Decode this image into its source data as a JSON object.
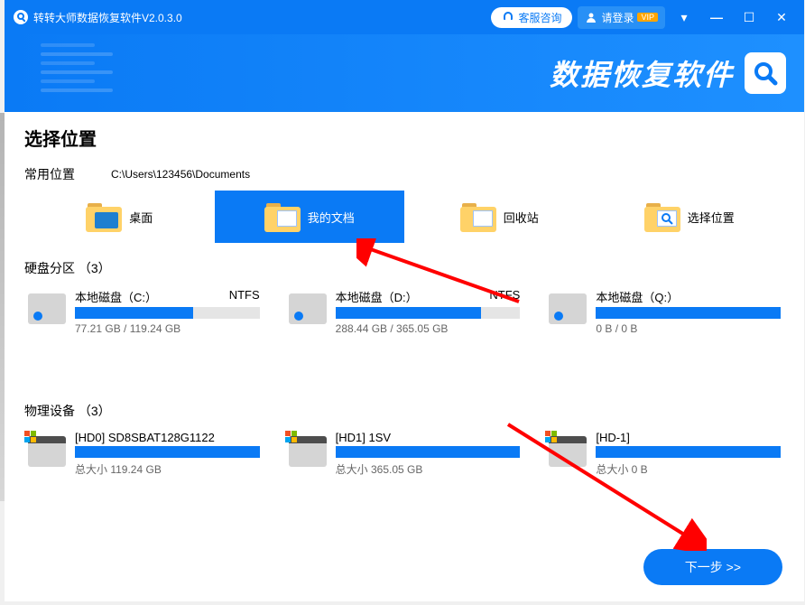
{
  "titlebar": {
    "appTitle": "转转大师数据恢复软件V2.0.3.0",
    "csButton": "客服咨询",
    "loginButton": "请登录",
    "vip": "VIP"
  },
  "banner": {
    "title": "数据恢复软件"
  },
  "sections": {
    "pageTitle": "选择位置",
    "commonLabel": "常用位置",
    "commonPath": "C:\\Users\\123456\\Documents",
    "diskLabel": "硬盘分区 （3）",
    "deviceLabel": "物理设备 （3）"
  },
  "locations": [
    {
      "label": "桌面",
      "sel": false
    },
    {
      "label": "我的文档",
      "sel": true
    },
    {
      "label": "回收站",
      "sel": false
    },
    {
      "label": "选择位置",
      "sel": false
    }
  ],
  "disks": [
    {
      "name": "本地磁盘（C:）",
      "fs": "NTFS",
      "used": "77.21 GB / 119.24 GB",
      "pct": 64
    },
    {
      "name": "本地磁盘（D:）",
      "fs": "NTFS",
      "used": "288.44 GB / 365.05 GB",
      "pct": 79
    },
    {
      "name": "本地磁盘（Q:）",
      "fs": "",
      "used": "0 B / 0 B",
      "pct": 100
    }
  ],
  "devices": [
    {
      "name": "[HD0] SD8SBAT128G1122",
      "size": "总大小 119.24 GB"
    },
    {
      "name": "[HD1] 1SV",
      "size": "总大小 365.05 GB"
    },
    {
      "name": "[HD-1]",
      "size": "总大小 0 B"
    }
  ],
  "nextButton": "下一步 >>"
}
